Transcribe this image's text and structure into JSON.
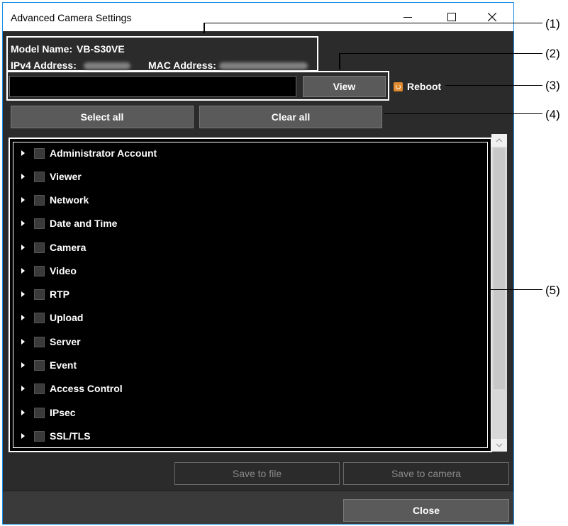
{
  "window": {
    "title": "Advanced Camera Settings",
    "controls": {
      "minimize": "—",
      "maximize": "☐",
      "close": "✕"
    }
  },
  "info": {
    "model_label": "Model Name:",
    "model_value": "VB-S30VE",
    "ipv4_label": "IPv4 Address:",
    "mac_label": "MAC Address:"
  },
  "view_input": {
    "value": ""
  },
  "buttons": {
    "view": "View",
    "reboot": "Reboot",
    "select_all": "Select all",
    "clear_all": "Clear all",
    "save_to_file": "Save to file",
    "save_to_camera": "Save to camera",
    "close": "Close"
  },
  "tree": {
    "items": [
      {
        "label": "Administrator Account"
      },
      {
        "label": "Viewer"
      },
      {
        "label": "Network"
      },
      {
        "label": "Date and Time"
      },
      {
        "label": "Camera"
      },
      {
        "label": "Video"
      },
      {
        "label": "RTP"
      },
      {
        "label": "Upload"
      },
      {
        "label": "Server"
      },
      {
        "label": "Event"
      },
      {
        "label": "Access Control"
      },
      {
        "label": "IPsec"
      },
      {
        "label": "SSL/TLS"
      }
    ]
  },
  "callouts": [
    "(1)",
    "(2)",
    "(3)",
    "(4)",
    "(5)"
  ],
  "colors": {
    "window_border": "#1b8fe6",
    "background": "#2b2b2b",
    "reboot_icon": "#e08a2e"
  },
  "icons": {
    "reboot": "power-icon",
    "tree_expand": "caret-right-icon"
  }
}
